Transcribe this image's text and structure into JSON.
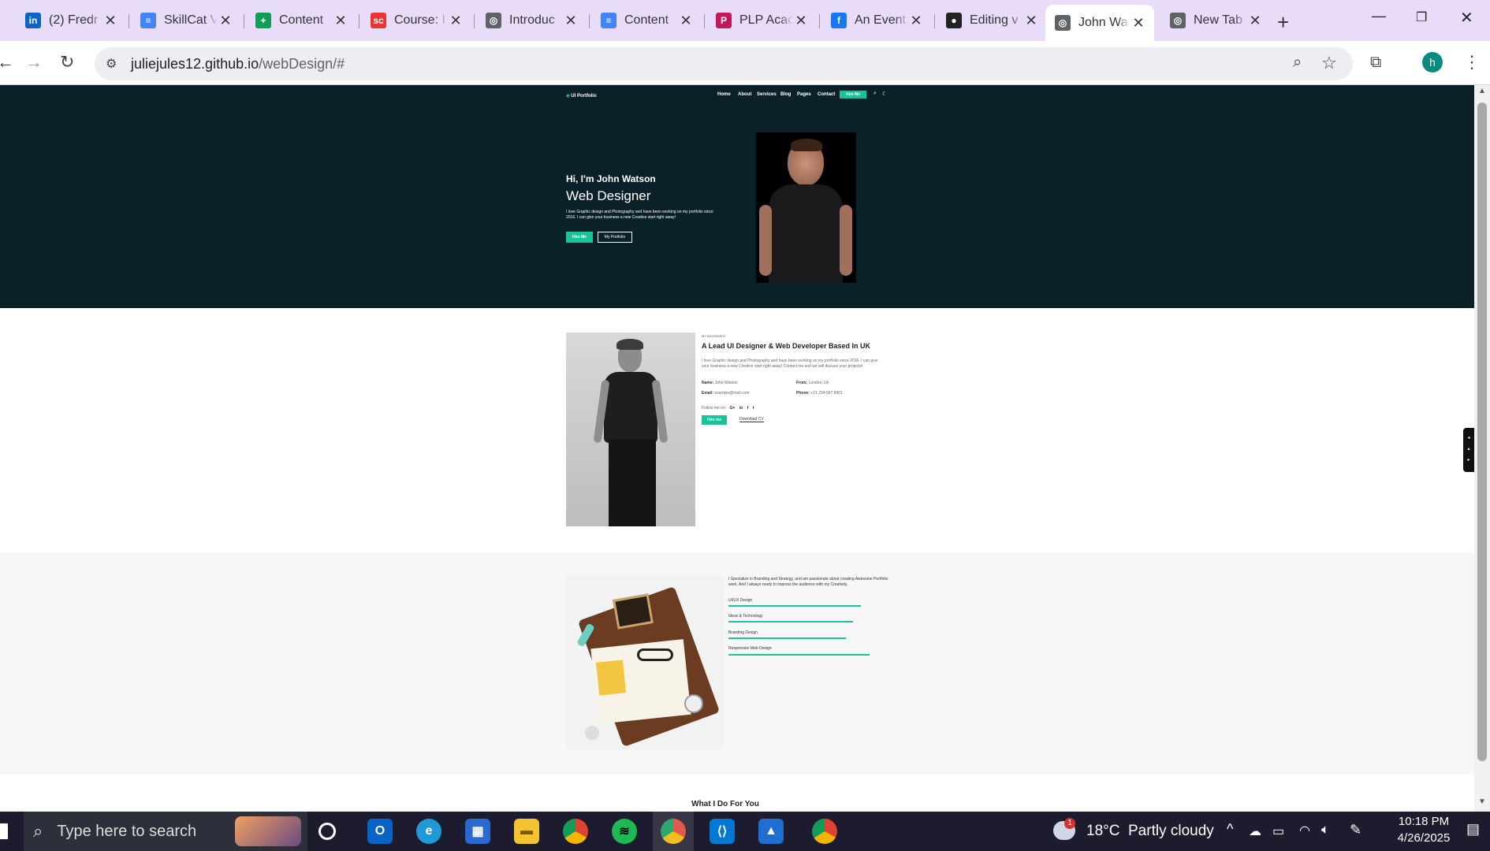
{
  "browser": {
    "tabs": [
      {
        "title": "(2) Fredr",
        "icon": "linkedin-icon",
        "color": "#0a66c2",
        "glyph": "in"
      },
      {
        "title": "SkillCat V",
        "icon": "google-docs-icon",
        "color": "#4285f4",
        "glyph": "≡"
      },
      {
        "title": "Content",
        "icon": "google-sheets-icon",
        "color": "#0f9d58",
        "glyph": "+"
      },
      {
        "title": "Course: I",
        "icon": "skillcat-icon",
        "color": "#e33",
        "glyph": "sc"
      },
      {
        "title": "Introduc",
        "icon": "globe-icon",
        "color": "#5f6368",
        "glyph": "◎"
      },
      {
        "title": "Content",
        "icon": "google-docs-icon",
        "color": "#4285f4",
        "glyph": "≡"
      },
      {
        "title": "PLP Acac",
        "icon": "plp-icon",
        "color": "#c2185b",
        "glyph": "P"
      },
      {
        "title": "An Event",
        "icon": "facebook-icon",
        "color": "#1877f2",
        "glyph": "f"
      },
      {
        "title": "Editing v",
        "icon": "github-icon",
        "color": "#222",
        "glyph": "●"
      },
      {
        "title": "John Wa",
        "icon": "globe-icon",
        "color": "#5f6368",
        "glyph": "◎",
        "active": true
      },
      {
        "title": "New Tab",
        "icon": "globe-icon",
        "color": "#5f6368",
        "glyph": "◎"
      }
    ],
    "new_tab": "+",
    "url_host": "juliejules12.github.io",
    "url_path": "/webDesign/#",
    "profile": "h"
  },
  "site": {
    "brand": "UI Portfolio",
    "nav": [
      "Home",
      "About",
      "Services",
      "Blog",
      "Pages",
      "Contact"
    ],
    "nav_cta": "Hire Me",
    "hero": {
      "greeting": "Hi, I'm John Watson",
      "role": "Web Designer",
      "desc": "I love Graphic design and Photography and have been working on my portfolio since 2016. I can give your business a new Creative start right away!",
      "btn_primary": "Hire Me",
      "btn_secondary": "My Portfolio"
    },
    "about": {
      "kicker": "MY BIOGRAPHY",
      "title": "A Lead UI Designer & Web Developer Based In UK",
      "desc": "I love Graphic design and Photography and have been working on my portfolio since 2016. I can give your business a new Creative start right away! Contact me and we will discuss your projects!",
      "name_label": "Name:",
      "name_value": "John Watson",
      "from_label": "From:",
      "from_value": "London, Uk",
      "email_label": "Email:",
      "email_value": "example@mail.com",
      "phone_label": "Phone:",
      "phone_value": "+21 234 567 8901",
      "follow": "Follow me on:",
      "social": [
        "G+",
        "in",
        "f",
        "t"
      ],
      "btn_hire": "Hire me",
      "btn_cv": "Download CV"
    },
    "skills": {
      "intro": "I Specialize in Branding and Strategy, and am passionate about creating Awesome Portfolio work. And I always ready to impress the audience with my Creativity.",
      "items": [
        {
          "label": "UI/UX Design",
          "level": 0.8
        },
        {
          "label": "Ideas & Technology",
          "level": 0.75
        },
        {
          "label": "Branding Design",
          "level": 0.71
        },
        {
          "label": "Responsive Web Design",
          "level": 0.85
        }
      ]
    },
    "services_heading": "What I Do For You"
  },
  "taskbar": {
    "search_placeholder": "Type here to search",
    "weather": "18°C  Partly cloudy",
    "weather_badge": "1",
    "time": "10:18 PM",
    "date": "4/26/2025"
  }
}
